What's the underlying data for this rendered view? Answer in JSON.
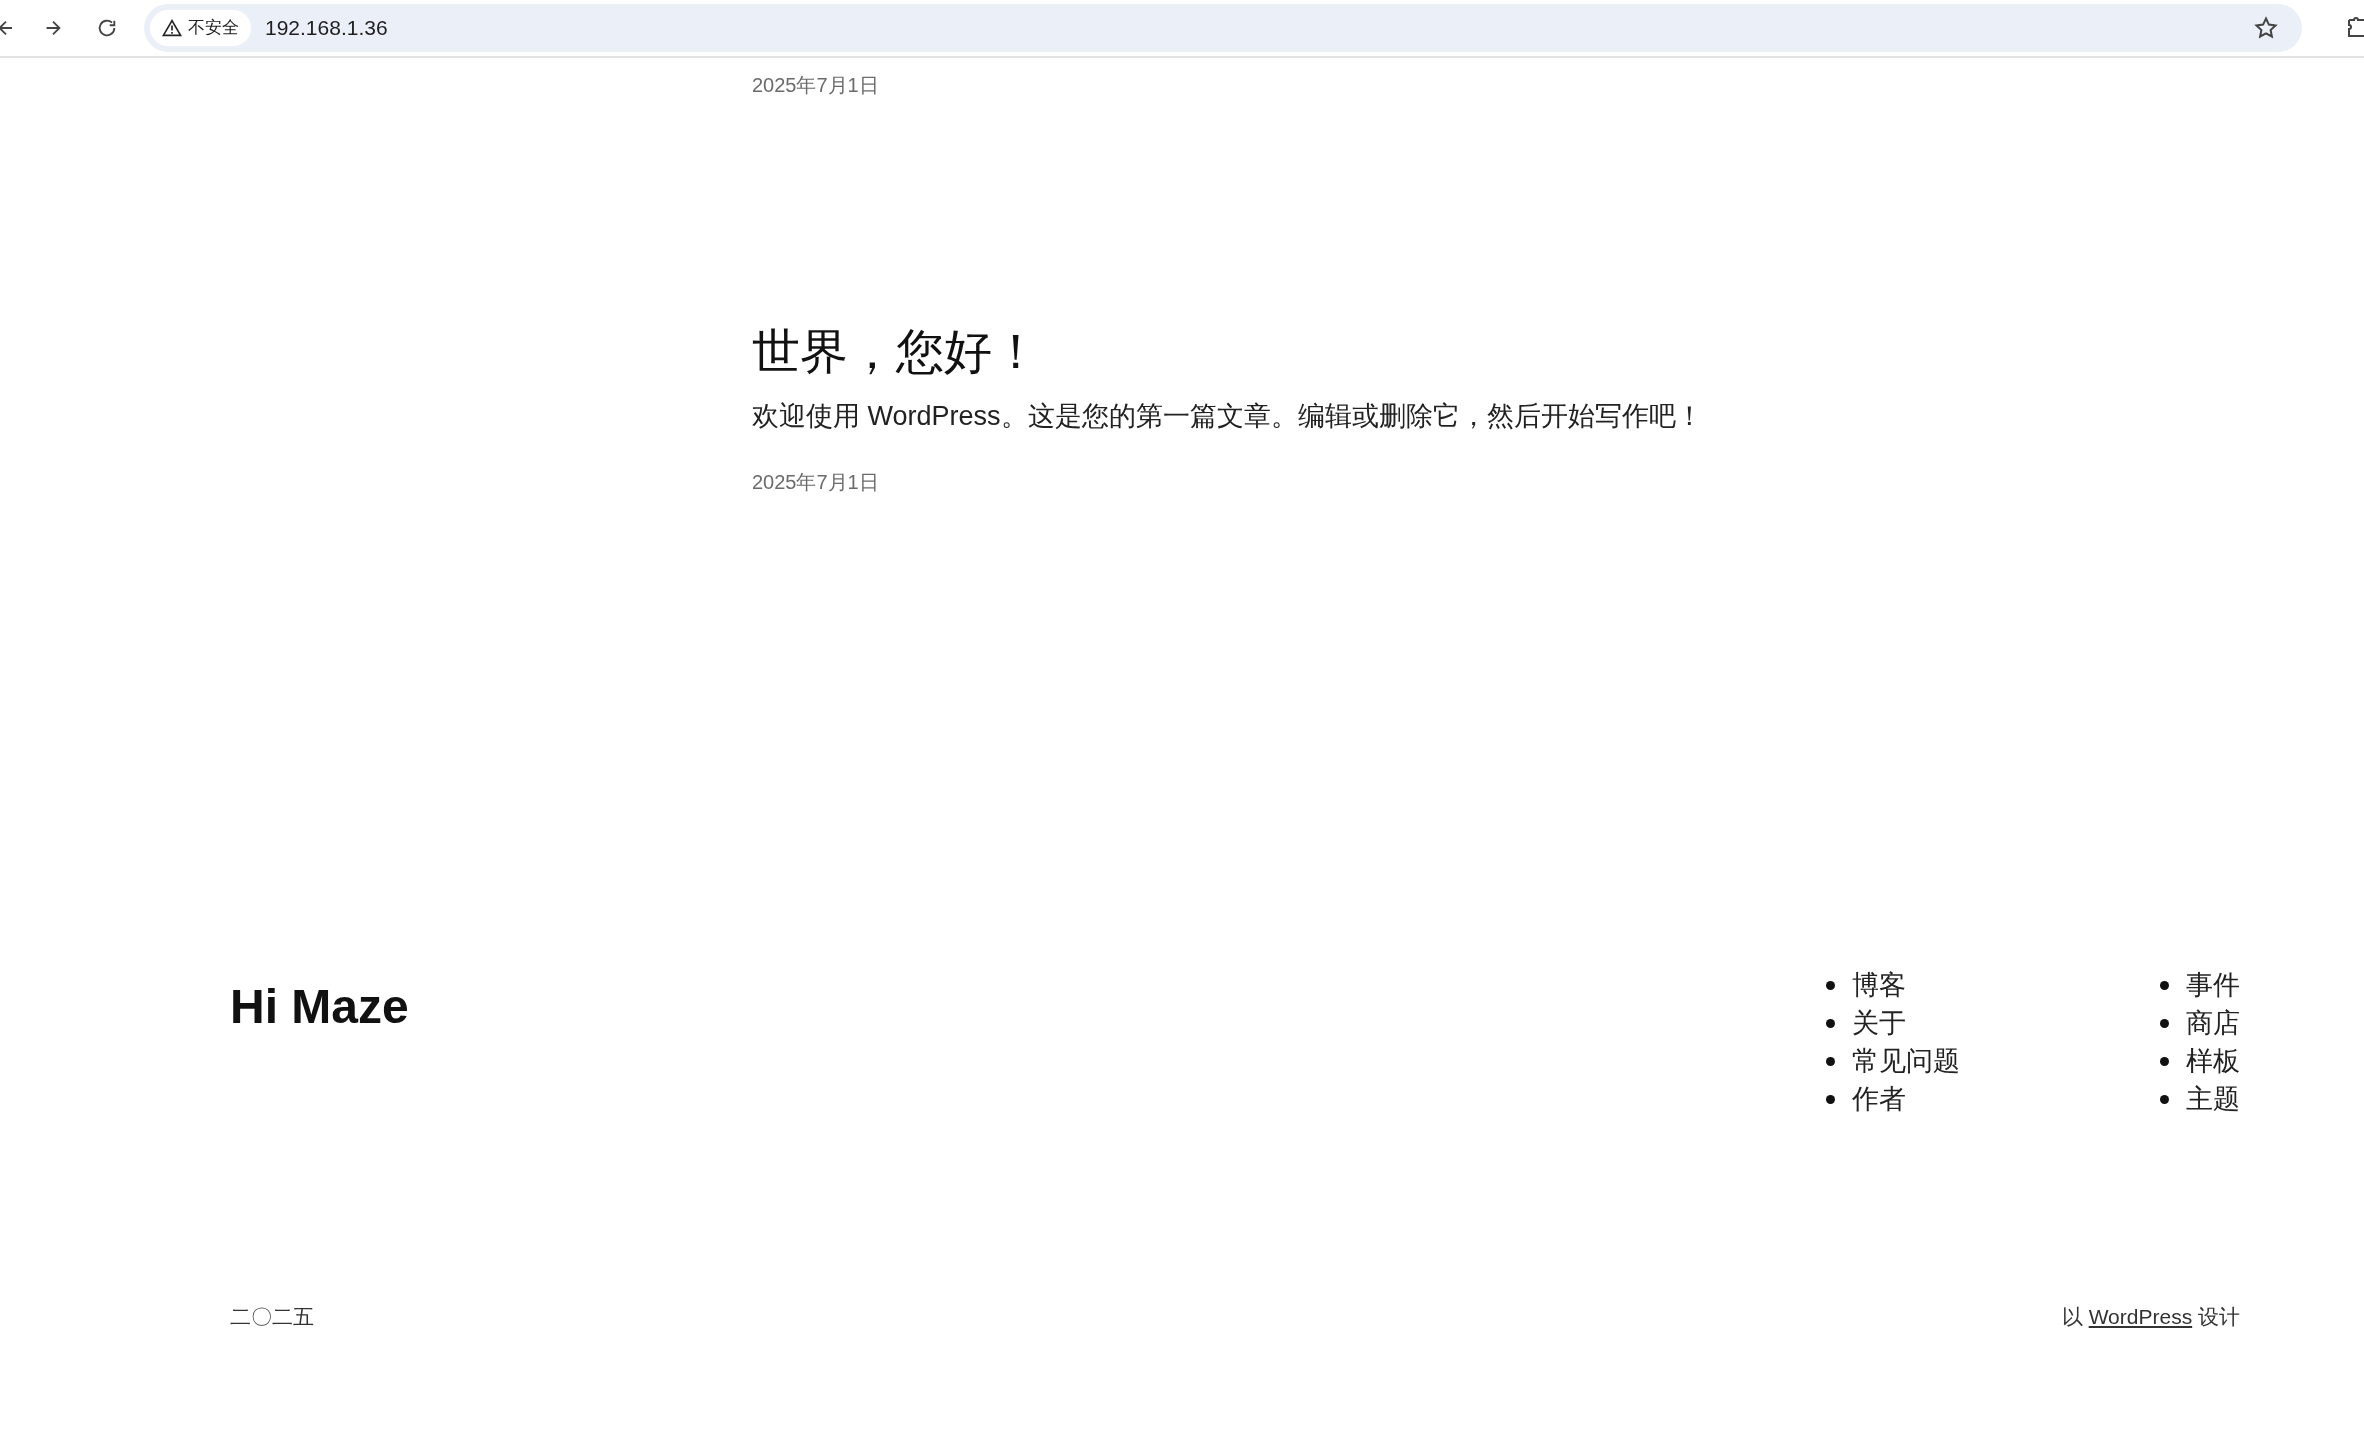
{
  "browser": {
    "security_label": "不安全",
    "url": "192.168.1.36"
  },
  "top_date": "2025年7月1日",
  "post": {
    "title": "世界，您好！",
    "body": "欢迎使用 WordPress。这是您的第一篇文章。编辑或删除它，然后开始写作吧！",
    "date": "2025年7月1日"
  },
  "footer": {
    "site_title": "Hi Maze",
    "menu_columns": [
      [
        "博客",
        "关于",
        "常见问题",
        "作者"
      ],
      [
        "事件",
        "商店",
        "样板",
        "主题"
      ]
    ],
    "year": "二〇二五",
    "credit_prefix": "以",
    "credit_link": "WordPress",
    "credit_suffix": "设计"
  }
}
